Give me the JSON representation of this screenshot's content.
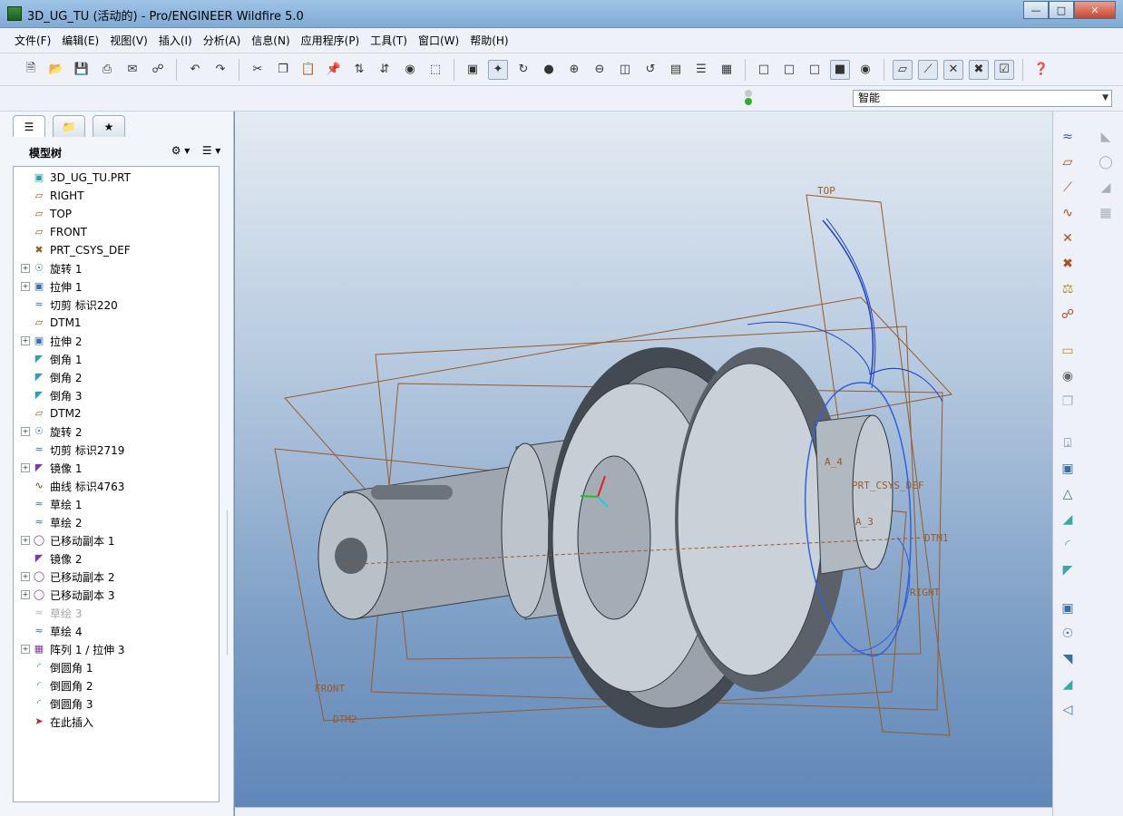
{
  "window": {
    "title": "3D_UG_TU (活动的) - Pro/ENGINEER Wildfire 5.0"
  },
  "menu": [
    "文件(F)",
    "编辑(E)",
    "视图(V)",
    "插入(I)",
    "分析(A)",
    "信息(N)",
    "应用程序(P)",
    "工具(T)",
    "窗口(W)",
    "帮助(H)"
  ],
  "filter_select": {
    "value": "智能"
  },
  "model_tree": {
    "header": "模型树",
    "items": [
      {
        "label": "3D_UG_TU.PRT",
        "expandable": false,
        "icon": "part-icon"
      },
      {
        "label": "RIGHT",
        "expandable": false,
        "icon": "datum-plane-icon"
      },
      {
        "label": "TOP",
        "expandable": false,
        "icon": "datum-plane-icon"
      },
      {
        "label": "FRONT",
        "expandable": false,
        "icon": "datum-plane-icon"
      },
      {
        "label": "PRT_CSYS_DEF",
        "expandable": false,
        "icon": "csys-icon"
      },
      {
        "label": "旋转 1",
        "expandable": true,
        "icon": "revolve-icon"
      },
      {
        "label": "拉伸 1",
        "expandable": true,
        "icon": "extrude-icon"
      },
      {
        "label": "切剪 标识220",
        "expandable": false,
        "icon": "cut-icon"
      },
      {
        "label": "DTM1",
        "expandable": false,
        "icon": "datum-plane-icon"
      },
      {
        "label": "拉伸 2",
        "expandable": true,
        "icon": "extrude-icon"
      },
      {
        "label": "倒角 1",
        "expandable": false,
        "icon": "chamfer-icon"
      },
      {
        "label": "倒角 2",
        "expandable": false,
        "icon": "chamfer-icon"
      },
      {
        "label": "倒角 3",
        "expandable": false,
        "icon": "chamfer-icon"
      },
      {
        "label": "DTM2",
        "expandable": false,
        "icon": "datum-plane-icon"
      },
      {
        "label": "旋转 2",
        "expandable": true,
        "icon": "revolve-icon"
      },
      {
        "label": "切剪 标识2719",
        "expandable": false,
        "icon": "cut-icon"
      },
      {
        "label": "镜像 1",
        "expandable": true,
        "icon": "mirror-icon"
      },
      {
        "label": "曲线 标识4763",
        "expandable": false,
        "icon": "curve-icon"
      },
      {
        "label": "草绘 1",
        "expandable": false,
        "icon": "sketch-icon"
      },
      {
        "label": "草绘 2",
        "expandable": false,
        "icon": "sketch-icon"
      },
      {
        "label": "已移动副本 1",
        "expandable": true,
        "icon": "moved-copy-icon"
      },
      {
        "label": "镜像 2",
        "expandable": false,
        "icon": "mirror-icon"
      },
      {
        "label": "已移动副本 2",
        "expandable": true,
        "icon": "moved-copy-icon"
      },
      {
        "label": "已移动副本 3",
        "expandable": true,
        "icon": "moved-copy-icon"
      },
      {
        "label": "草绘 3",
        "expandable": false,
        "icon": "sketch-icon",
        "dim": true
      },
      {
        "label": "草绘 4",
        "expandable": false,
        "icon": "sketch-icon"
      },
      {
        "label": "阵列 1 / 拉伸 3",
        "expandable": true,
        "icon": "pattern-icon"
      },
      {
        "label": "倒圆角 1",
        "expandable": false,
        "icon": "round-icon"
      },
      {
        "label": "倒圆角 2",
        "expandable": false,
        "icon": "round-icon"
      },
      {
        "label": "倒圆角 3",
        "expandable": false,
        "icon": "round-icon"
      },
      {
        "label": "在此插入",
        "expandable": false,
        "icon": "insert-here-icon"
      }
    ]
  },
  "viewport_labels": {
    "top": "TOP",
    "front": "FRONT",
    "right": "RIGHT",
    "dtm1": "DTM1",
    "dtm2": "DTM2",
    "csys": "PRT_CSYS_DEF",
    "axis_a4": "A_4",
    "axis_a3": "A_3"
  }
}
